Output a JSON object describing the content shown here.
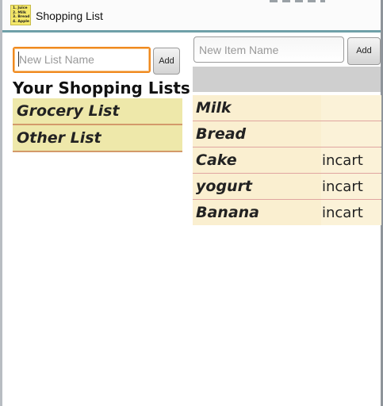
{
  "app": {
    "title": "Shopping List",
    "icon_lines": [
      "1. Juice",
      "2. Milk",
      "3. Bread",
      "4. Apple"
    ]
  },
  "left_pane": {
    "list_name_placeholder": "New List Name",
    "add_label": "Add",
    "heading": "Your Shopping Lists",
    "lists": [
      {
        "label": "Grocery List"
      },
      {
        "label": "Other List"
      }
    ]
  },
  "right_pane": {
    "item_name_placeholder": "New Item Name",
    "add_label": "Add",
    "items": [
      {
        "name": "Milk",
        "status": ""
      },
      {
        "name": "Bread",
        "status": ""
      },
      {
        "name": "Cake",
        "status": "incart"
      },
      {
        "name": "yogurt",
        "status": "incart"
      },
      {
        "name": "Banana",
        "status": "incart"
      }
    ]
  }
}
